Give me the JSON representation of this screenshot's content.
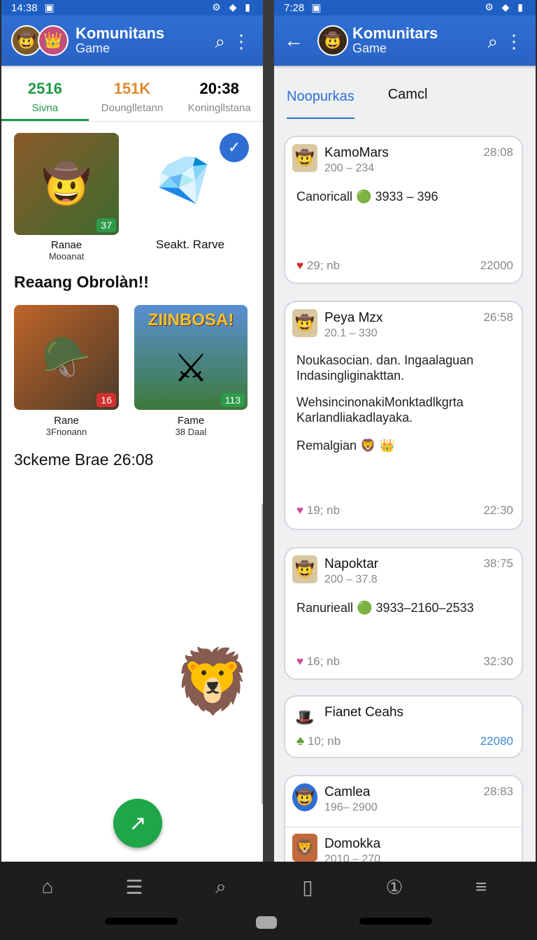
{
  "left": {
    "status": {
      "time": "14:38",
      "icons": "▣"
    },
    "appbar": {
      "title": "Komunitans",
      "subtitle": "Game"
    },
    "stats": [
      {
        "num": "2516",
        "label": "Sivna",
        "color": "#1f9a46"
      },
      {
        "num": "151K",
        "label": "Dounglletann",
        "color": "#e08a2e"
      },
      {
        "num": "20:38",
        "label": "Koningllstana",
        "color": "#111111"
      }
    ],
    "featured": [
      {
        "caption": "Ranae",
        "sub": "Mooanat",
        "badge": "37"
      },
      {
        "caption": "Seakt. Rarve",
        "sub": ""
      }
    ],
    "section1": "Reaang Obrolàn!!",
    "games": [
      {
        "caption": "Rane",
        "sub": "3Fnonann",
        "badge": "16"
      },
      {
        "caption": "Fame",
        "sub": "38 Daal",
        "badge": "113",
        "banner": "ZIINBOSA!"
      }
    ],
    "section2": "3ckeme Brae 26:08",
    "fab_icon": "↗"
  },
  "right": {
    "status": {
      "time": "7:28",
      "icons": "▣"
    },
    "appbar": {
      "title": "Komunitars",
      "subtitle": "Game"
    },
    "tabs": [
      {
        "label": "Noopurkas",
        "active": true
      },
      {
        "label": "Camcl",
        "active": false
      }
    ],
    "cards": [
      {
        "name": "KamoMars",
        "sub": "200 – 234",
        "time": "28:08",
        "lines": [
          "Canoricall 🟢 3933 – 396"
        ],
        "foot": "29; nb",
        "footr": "22000"
      },
      {
        "name": "Peya Mzx",
        "sub": "20.1 – 330",
        "time": "26:58",
        "lines": [
          "Noukasocian. dan. Ingaalaguan",
          "Indasingliginakttan.",
          "",
          "WehsincinonakiMonktadlkgrta",
          "Karlandliakadlayaka.",
          "",
          "Remalgian 🦁 👑"
        ],
        "foot": "19; nb",
        "footr": "22:30"
      },
      {
        "name": "Napoktar",
        "sub": "200 – 37.8",
        "time": "38:75",
        "lines": [
          "Ranurieall 🟢 3933–2160–2533"
        ],
        "foot": "16; nb",
        "footr": "32:30"
      },
      {
        "name": "Fianet Ceahs",
        "sub": "",
        "time": "",
        "lines": [],
        "foot": "10; nb",
        "footr": "22080"
      },
      {
        "name": "Camlea",
        "sub": "196– 2900",
        "time": "28:83",
        "lines": [],
        "foot": "",
        "footr": ""
      },
      {
        "name": "Domokka",
        "sub": "2010 – 270",
        "time": "",
        "lines": [],
        "foot": "",
        "footr": ""
      }
    ]
  },
  "nav": [
    "home-icon",
    "layers-icon",
    "search-icon",
    "book-icon",
    "info-icon",
    "menu-icon"
  ]
}
